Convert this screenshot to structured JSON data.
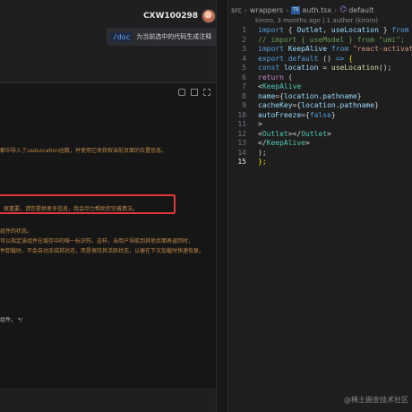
{
  "chat": {
    "username": "CXW100298",
    "command": "/doc",
    "request": "为当前选中的代码生成注释",
    "lines": [
      "都中导入了useLocation函数，并使用它来获取当前页面的位置信息。",
      "很重要，请您提供更多信息，我会尽力帮助您完善算法。",
      "组件的状态。",
      "可以指定该组件在缓存中的唯一标识符。这样，当用户导航到其他页面再返回时，",
      "件卸载时，不会自动冻结其状态，而是保持其活跃状态，以便在下次加载时快速恢复。",
      "组件。 */"
    ]
  },
  "editor": {
    "breadcrumb": [
      "src",
      "wrappers",
      "auth.tsx",
      "default"
    ],
    "blame": "kiroro, 3 months ago | 1 author (kiroro)",
    "line_numbers": [
      "1",
      "2",
      "3",
      "4",
      "5",
      "6",
      "7",
      "8",
      "9",
      "10",
      "11",
      "12",
      "13",
      "14",
      "15"
    ],
    "code": [
      [
        [
          "kw",
          "import "
        ],
        [
          "pun",
          "{ "
        ],
        [
          "var",
          "Outlet"
        ],
        [
          "pun",
          ", "
        ],
        [
          "var",
          "useLocation"
        ],
        [
          "pun",
          " } "
        ],
        [
          "kw",
          "from "
        ],
        [
          "str",
          "\"umi\""
        ]
      ],
      [
        [
          "cmt",
          "// import { useModel } from \"umi\";"
        ]
      ],
      [
        [
          "kw",
          "import "
        ],
        [
          "var",
          "KeepAlive "
        ],
        [
          "kw",
          "from "
        ],
        [
          "str",
          "\"react-activation\""
        ],
        [
          "pun",
          ";"
        ]
      ],
      [
        [
          "kw",
          "export default "
        ],
        [
          "pun",
          "() "
        ],
        [
          "kw",
          "=> "
        ],
        [
          "br",
          "{"
        ]
      ],
      [
        [
          "pun",
          "  "
        ],
        [
          "kw",
          "const "
        ],
        [
          "var",
          "location "
        ],
        [
          "pun",
          "= "
        ],
        [
          "fn",
          "useLocation"
        ],
        [
          "pun",
          "();"
        ]
      ],
      [
        [
          "pun",
          "  "
        ],
        [
          "ctl",
          "return "
        ],
        [
          "pun",
          "("
        ]
      ],
      [
        [
          "pun",
          "    <"
        ],
        [
          "tag",
          "KeepAlive"
        ]
      ],
      [
        [
          "pun",
          "      "
        ],
        [
          "attr",
          "name"
        ],
        [
          "pun",
          "={"
        ],
        [
          "var",
          "location"
        ],
        [
          "pun",
          "."
        ],
        [
          "var",
          "pathname"
        ],
        [
          "pun",
          "}"
        ]
      ],
      [
        [
          "pun",
          "      "
        ],
        [
          "attr",
          "cacheKey"
        ],
        [
          "pun",
          "={"
        ],
        [
          "var",
          "location"
        ],
        [
          "pun",
          "."
        ],
        [
          "var",
          "pathname"
        ],
        [
          "pun",
          "}"
        ]
      ],
      [
        [
          "pun",
          "      "
        ],
        [
          "attr",
          "autoFreeze"
        ],
        [
          "pun",
          "={"
        ],
        [
          "kw",
          "false"
        ],
        [
          "pun",
          "}"
        ]
      ],
      [
        [
          "pun",
          "    >"
        ]
      ],
      [
        [
          "pun",
          "      <"
        ],
        [
          "tag",
          "Outlet"
        ],
        [
          "pun",
          "></"
        ],
        [
          "tag",
          "Outlet"
        ],
        [
          "pun",
          ">"
        ]
      ],
      [
        [
          "pun",
          "    </"
        ],
        [
          "tag",
          "KeepAlive"
        ],
        [
          "pun",
          ">"
        ]
      ],
      [
        [
          "pun",
          "  );"
        ]
      ],
      [
        [
          "br",
          "};"
        ]
      ]
    ]
  },
  "watermark": "@稀土掘金技术社区",
  "colors": {
    "highlight": "#e0383e",
    "accent": "#6aa4ff"
  }
}
